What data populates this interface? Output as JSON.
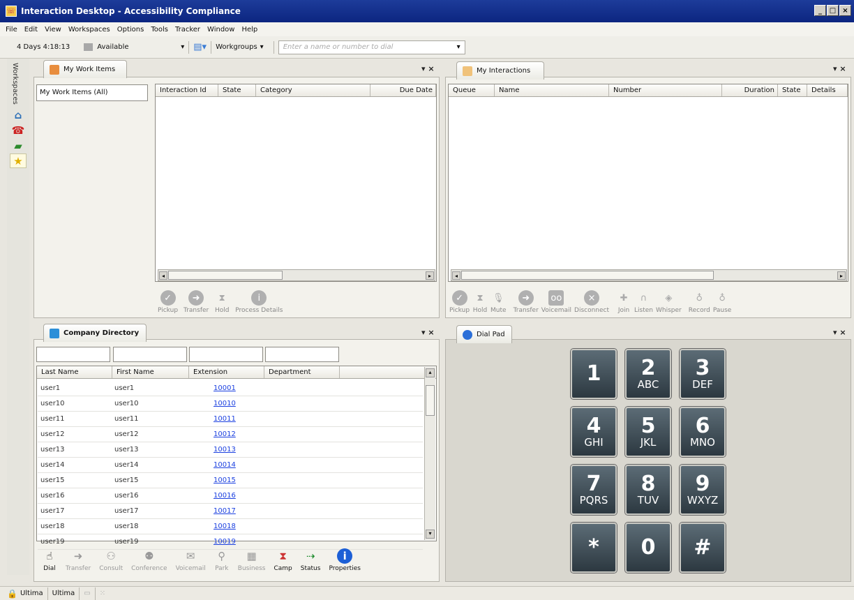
{
  "window": {
    "title": "Interaction Desktop - Accessibility Compliance",
    "controls": [
      "_",
      "□",
      "×"
    ]
  },
  "menu": [
    "File",
    "Edit",
    "View",
    "Workspaces",
    "Options",
    "Tools",
    "Tracker",
    "Window",
    "Help"
  ],
  "toolbar": {
    "time_in_status": "4 Days 4:18:13",
    "status": "Available",
    "workgroups": "Workgroups",
    "dial_placeholder": "Enter a name or number to dial"
  },
  "sidebar": {
    "label": "Workspaces"
  },
  "work_items": {
    "tab": "My Work Items",
    "tree_item": "My Work Items (All)",
    "columns": [
      "Interaction Id",
      "State",
      "Category",
      "Due Date"
    ],
    "actions": [
      "Pickup",
      "Transfer",
      "Hold",
      "Process Details"
    ]
  },
  "interactions": {
    "tab": "My Interactions",
    "columns": [
      "Queue",
      "Name",
      "Number",
      "Duration",
      "State",
      "Details"
    ],
    "actions": [
      "Pickup",
      "Hold",
      "Mute",
      "Transfer",
      "Voicemail",
      "Disconnect",
      "Join",
      "Listen",
      "Whisper",
      "Record",
      "Pause"
    ]
  },
  "directory": {
    "tab": "Company Directory",
    "columns": [
      "Last Name",
      "First Name",
      "Extension",
      "Department"
    ],
    "rows": [
      [
        "user1",
        "user1",
        "10001"
      ],
      [
        "user10",
        "user10",
        "10010"
      ],
      [
        "user11",
        "user11",
        "10011"
      ],
      [
        "user12",
        "user12",
        "10012"
      ],
      [
        "user13",
        "user13",
        "10013"
      ],
      [
        "user14",
        "user14",
        "10014"
      ],
      [
        "user15",
        "user15",
        "10015"
      ],
      [
        "user16",
        "user16",
        "10016"
      ],
      [
        "user17",
        "user17",
        "10017"
      ],
      [
        "user18",
        "user18",
        "10018"
      ],
      [
        "user19",
        "user19",
        "10019"
      ]
    ],
    "actions": [
      "Dial",
      "Transfer",
      "Consult",
      "Conference",
      "Voicemail",
      "Park",
      "Business",
      "Camp",
      "Status",
      "Properties"
    ]
  },
  "dialpad": {
    "tab": "Dial Pad",
    "keys": [
      [
        "1",
        ""
      ],
      [
        "2",
        "ABC"
      ],
      [
        "3",
        "DEF"
      ],
      [
        "4",
        "GHI"
      ],
      [
        "5",
        "JKL"
      ],
      [
        "6",
        "MNO"
      ],
      [
        "7",
        "PQRS"
      ],
      [
        "8",
        "TUV"
      ],
      [
        "9",
        "WXYZ"
      ],
      [
        "*",
        ""
      ],
      [
        "0",
        ""
      ],
      [
        "#",
        ""
      ]
    ]
  },
  "statusbar": {
    "user1": "Ultima",
    "user2": "Ultima"
  }
}
